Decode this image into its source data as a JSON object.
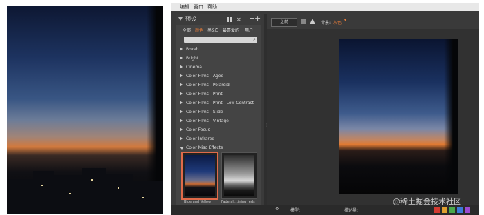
{
  "menu": {
    "items": [
      "编辑",
      "窗口",
      "帮助"
    ]
  },
  "presets_panel": {
    "title": "预设",
    "tabs": [
      "全部",
      "颜色",
      "黑&白",
      "最喜爱的",
      "用户"
    ],
    "active_tab": "颜色",
    "categories": [
      "Bokeh",
      "Bright",
      "Cinema",
      "Color Films - Aged",
      "Color Films - Polaroid",
      "Color Films - Print",
      "Color Films - Print - Low Contrast",
      "Color Films - Slide",
      "Color Films - Vintage",
      "Color Focus",
      "Color Infrared",
      "Color Misc Effects"
    ],
    "thumbnails": [
      {
        "label": "Blue and Yellow"
      },
      {
        "label": "Fade all...ining reds"
      }
    ]
  },
  "toolbar": {
    "before_label": "之前",
    "background_label": "背景:",
    "background_value": "灰色"
  },
  "bottom_bar": {
    "item1": "模型:",
    "item2": "描述量:"
  },
  "swatch_colors": [
    "#d33b32",
    "#e0a030",
    "#4aa84a",
    "#3c7ad8",
    "#9c4ad0"
  ],
  "watermark": "@稀土掘金技术社区"
}
